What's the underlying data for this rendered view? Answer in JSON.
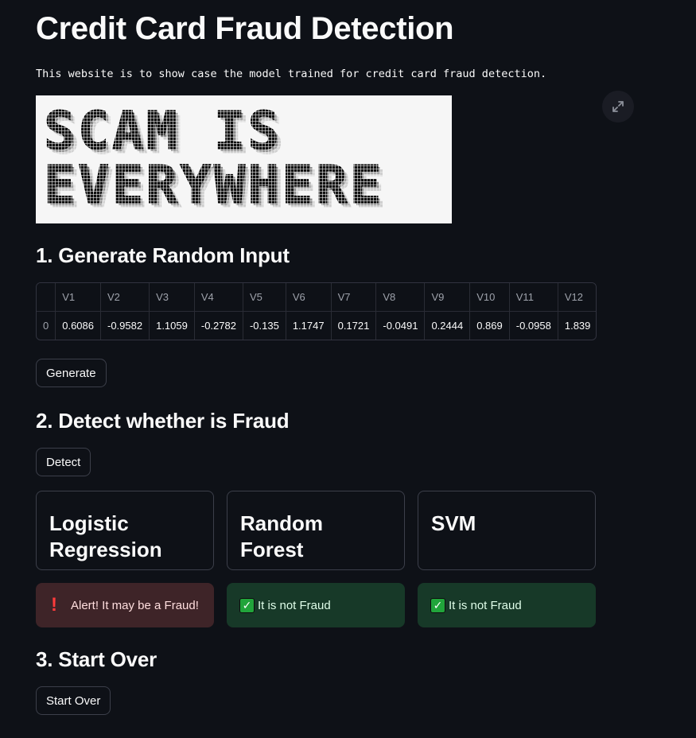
{
  "page": {
    "title": "Credit Card Fraud Detection",
    "subtitle": "This website is to show case the model trained for credit card fraud detection."
  },
  "banner": {
    "line1": "SCAM IS",
    "line2": "EVERYWHERE"
  },
  "section1": {
    "heading": "1. Generate Random Input",
    "button": "Generate"
  },
  "table": {
    "columns": [
      "",
      "V1",
      "V2",
      "V3",
      "V4",
      "V5",
      "V6",
      "V7",
      "V8",
      "V9",
      "V10",
      "V11",
      "V12"
    ],
    "rows": [
      [
        "0",
        "0.6086",
        "-0.9582",
        "1.1059",
        "-0.2782",
        "-0.135",
        "1.1747",
        "0.1721",
        "-0.0491",
        "0.2444",
        "0.869",
        "-0.0958",
        "1.839"
      ]
    ]
  },
  "section2": {
    "heading": "2. Detect whether is Fraud",
    "button": "Detect"
  },
  "models": [
    {
      "name": "Logistic Regression",
      "result": "Alert! It may be a Fraud!",
      "status": "fraud",
      "color": "#3e2428"
    },
    {
      "name": "Random Forest",
      "result": "It is not Fraud",
      "status": "ok",
      "color": "#173928"
    },
    {
      "name": "SVM",
      "result": "It is not Fraud",
      "status": "ok",
      "color": "#173928"
    }
  ],
  "section3": {
    "heading": "3. Start Over",
    "button": "Start Over"
  },
  "icons": {
    "expand": "expand-icon",
    "alert": "exclamation-icon",
    "check": "check-icon"
  },
  "colors": {
    "background": "#0e1117",
    "fraud_bg": "#3e2428",
    "ok_bg": "#173928",
    "alert_red": "#ff3b3b",
    "check_green": "#21a43b"
  }
}
